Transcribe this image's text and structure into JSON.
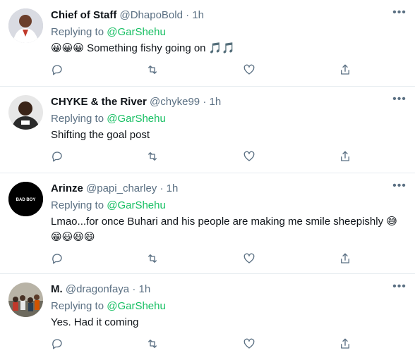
{
  "tweets": [
    {
      "name": "Chief of Staff",
      "handle": "@DhapoBold",
      "time": "1h",
      "replying_label": "Replying to",
      "replying_to": "@GarShehu",
      "text": "😀😀😀 Something fishy going on 🎵🎵",
      "avatar": "avatar-person-red-background"
    },
    {
      "name": "CHYKE & the River",
      "handle": "@chyke99",
      "time": "1h",
      "replying_label": "Replying to",
      "replying_to": "@GarShehu",
      "text": "Shifting the goal post",
      "avatar": "avatar-man-smiling"
    },
    {
      "name": "Arinze",
      "handle": "@papi_charley",
      "time": "1h",
      "replying_label": "Replying to",
      "replying_to": "@GarShehu",
      "text": "Lmao...for once Buhari and his people are making me smile sheepishly 😅",
      "text2": "😁😃😆😄",
      "avatar": "avatar-bad-boy",
      "avatar_text": "BAD BOY"
    },
    {
      "name": "M.",
      "handle": "@dragonfaya",
      "time": "1h",
      "replying_label": "Replying to",
      "replying_to": "@GarShehu",
      "text": "Yes. Had it coming",
      "avatar": "avatar-crowd-photo"
    }
  ],
  "colors": {
    "link_green": "#17bf63",
    "muted": "#5b7083",
    "divider": "#e6ecf0"
  },
  "icons": [
    "reply-icon",
    "retweet-icon",
    "like-icon",
    "share-icon",
    "more-icon"
  ],
  "separator": "·"
}
